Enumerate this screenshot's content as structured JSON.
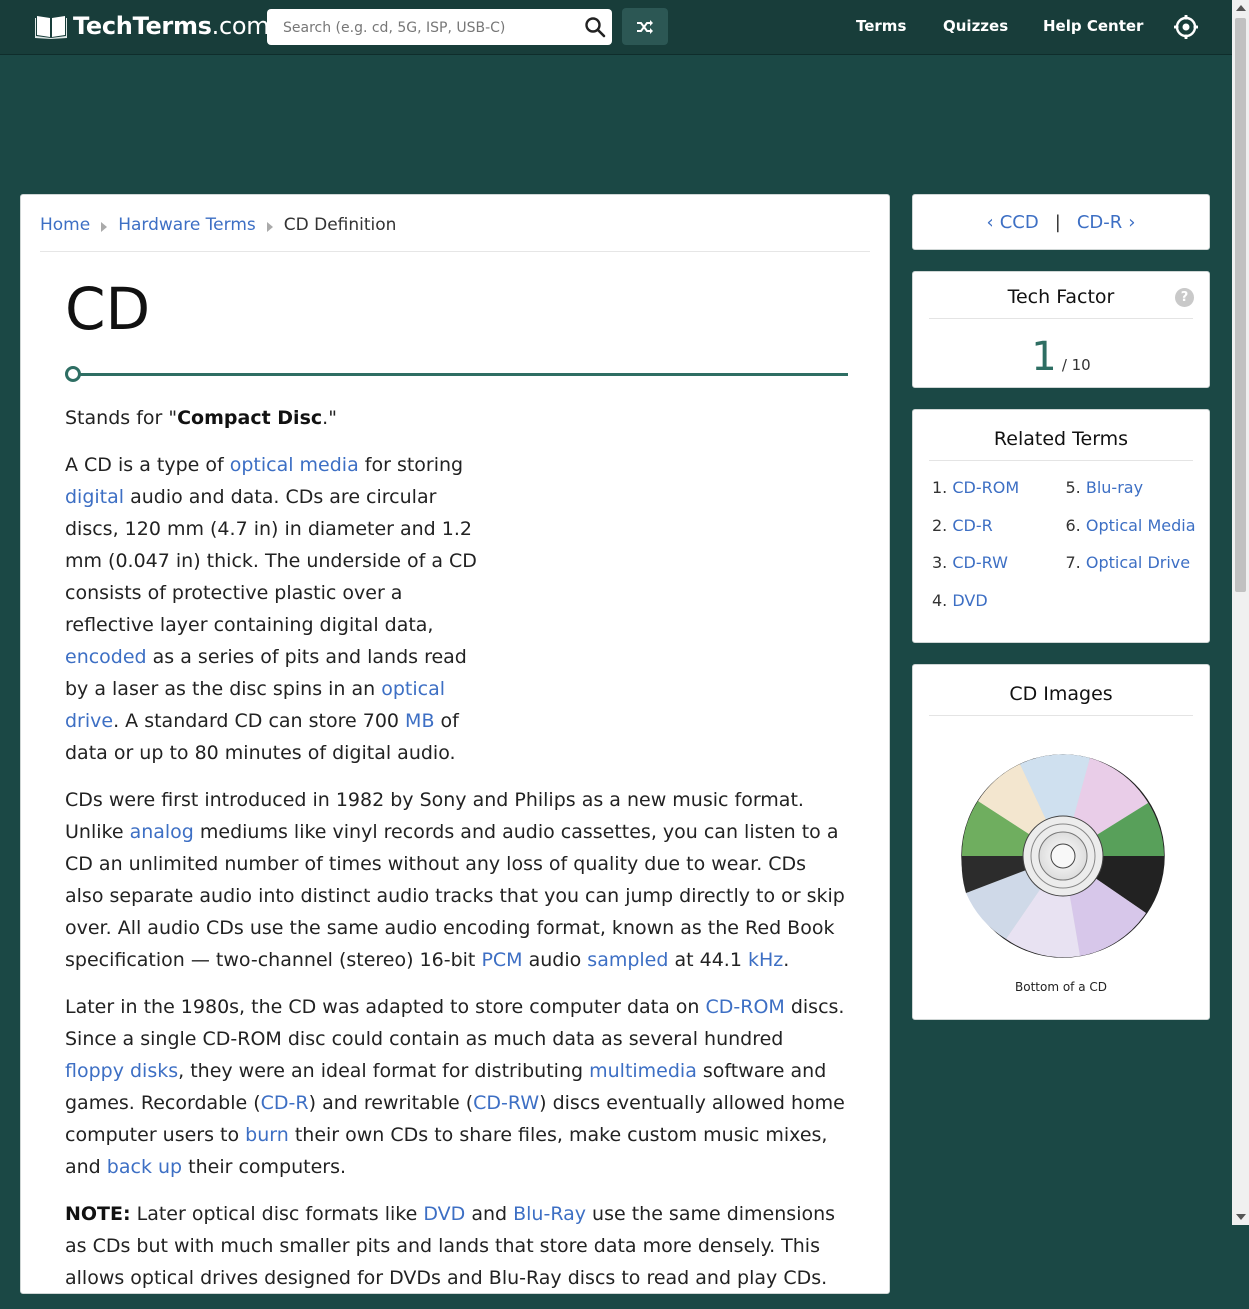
{
  "header": {
    "logo_bold": "TechTerms",
    "logo_suffix": ".com",
    "search_placeholder": "Search (e.g. cd, 5G, ISP, USB-C)",
    "nav": [
      "Terms",
      "Quizzes",
      "Help Center"
    ]
  },
  "breadcrumb": {
    "home": "Home",
    "category": "Hardware Terms",
    "current": "CD Definition"
  },
  "term": {
    "title": "CD",
    "stands_prefix": "Stands for \"",
    "stands_bold": "Compact Disc",
    "stands_suffix": ".\""
  },
  "body": {
    "p1": [
      {
        "t": "A CD is a type of "
      },
      {
        "l": "optical media"
      },
      {
        "t": " for storing "
      },
      {
        "l": "digital"
      },
      {
        "t": " audio and data. CDs are circular discs, 120 mm (4.7 in) in diameter and 1.2 mm (0.047 in) thick. The underside of a CD consists of protective plastic over a reflective layer containing digital data, "
      },
      {
        "l": "encoded"
      },
      {
        "t": " as a series of pits and lands read by a laser as the disc spins in an "
      },
      {
        "l": "optical drive"
      },
      {
        "t": ". A standard CD can store 700 "
      },
      {
        "l": "MB"
      },
      {
        "t": " of data or up to 80 minutes of digital audio."
      }
    ],
    "p2": [
      {
        "t": "CDs were first introduced in 1982 by Sony and Philips as a new music format. Unlike "
      },
      {
        "l": "analog"
      },
      {
        "t": " mediums like vinyl records and audio cassettes, you can listen to a CD an unlimited number of times without any loss of quality due to wear. CDs also separate audio into distinct audio tracks that you can jump directly to or skip over. All audio CDs use the same audio encoding format, known as the Red Book specification — two-channel (stereo) 16-bit "
      },
      {
        "l": "PCM"
      },
      {
        "t": " audio "
      },
      {
        "l": "sampled"
      },
      {
        "t": " at 44.1 "
      },
      {
        "l": "kHz"
      },
      {
        "t": "."
      }
    ],
    "p3": [
      {
        "t": "Later in the 1980s, the CD was adapted to store computer data on "
      },
      {
        "l": "CD-ROM"
      },
      {
        "t": " discs. Since a single CD-ROM disc could contain as much data as several hundred "
      },
      {
        "l": "floppy disks"
      },
      {
        "t": ", they were an ideal format for distributing "
      },
      {
        "l": "multimedia"
      },
      {
        "t": " software and games. Recordable ("
      },
      {
        "l": "CD-R"
      },
      {
        "t": ") and rewritable ("
      },
      {
        "l": "CD-RW"
      },
      {
        "t": ") discs eventually allowed home computer users to "
      },
      {
        "l": "burn"
      },
      {
        "t": " their own CDs to share files, make custom music mixes, and "
      },
      {
        "l": "back up"
      },
      {
        "t": " their computers."
      }
    ],
    "p4": [
      {
        "b": "NOTE:"
      },
      {
        "t": " Later optical disc formats like "
      },
      {
        "l": "DVD"
      },
      {
        "t": " and "
      },
      {
        "l": "Blu-Ray"
      },
      {
        "t": " use the same dimensions as CDs but with much smaller pits and lands that store data more densely. This allows optical drives designed for DVDs and Blu-Ray discs to read and play CDs."
      }
    ]
  },
  "prevnext": {
    "prev": "CCD",
    "next": "CD-R",
    "separator": "|"
  },
  "tech_factor": {
    "title": "Tech Factor",
    "help": "?",
    "value": "1",
    "denominator": "/ 10"
  },
  "related": {
    "title": "Related Terms",
    "items": [
      {
        "num": "1.",
        "label": "CD-ROM"
      },
      {
        "num": "2.",
        "label": "CD-R"
      },
      {
        "num": "3.",
        "label": "CD-RW"
      },
      {
        "num": "4.",
        "label": "DVD"
      },
      {
        "num": "5.",
        "label": "Blu-ray"
      },
      {
        "num": "6.",
        "label": "Optical Media"
      },
      {
        "num": "7.",
        "label": "Optical Drive"
      }
    ]
  },
  "images": {
    "title": "CD Images",
    "caption": "Bottom of a CD"
  },
  "colors": {
    "header_bg": "#183d3a",
    "page_bg": "#1b4845",
    "link": "#3d6fc4",
    "accent": "#2e6e63"
  }
}
